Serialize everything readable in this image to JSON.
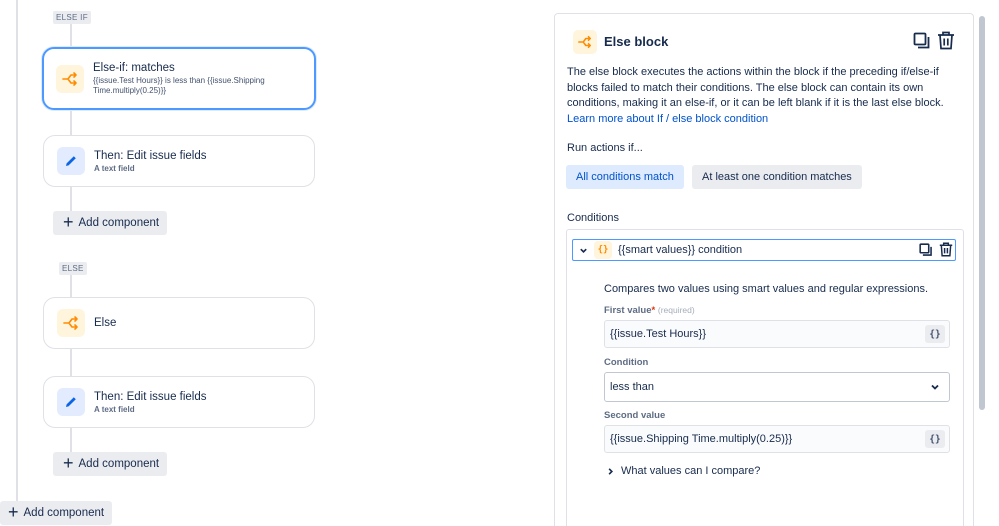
{
  "canvas": {
    "tags": {
      "else_if": "ELSE IF",
      "else": "ELSE"
    },
    "cards": [
      {
        "title": "Else-if: matches",
        "subtitle": "{{issue.Test Hours}} is less than {{issue.Shipping Time.multiply(0.25)}}",
        "icon": "branch-icon"
      },
      {
        "title": "Then: Edit issue fields",
        "subtitle": "A text field",
        "icon": "pencil-icon"
      },
      {
        "title": "Else",
        "subtitle": "",
        "icon": "branch-icon"
      },
      {
        "title": "Then: Edit issue fields",
        "subtitle": "A text field",
        "icon": "pencil-icon"
      }
    ],
    "add_component_label": "Add component"
  },
  "panel": {
    "title": "Else block",
    "description": "The else block executes the actions within the block if the preceding if/else-if blocks failed to match their conditions. The else block can contain its own conditions, making it an else-if, or it can be left blank if it is the last else block.",
    "learn_more": "Learn more about If / else block condition",
    "run_actions_label": "Run actions if...",
    "run_options": [
      "All conditions match",
      "At least one condition matches"
    ],
    "selected_run_option": "All conditions match",
    "conditions_label": "Conditions",
    "condition": {
      "icon_text": "{}",
      "title": "{{smart values}} condition",
      "description": "Compares two values using smart values and regular expressions.",
      "first_value_label": "First value",
      "required_mark": "*",
      "required_text": "(required)",
      "first_value": "{{issue.Test Hours}}",
      "condition_label": "Condition",
      "condition_value": "less than",
      "second_value_label": "Second value",
      "second_value": "{{issue.Shipping Time.multiply(0.25)}}",
      "smart_value_button": "{}",
      "compare_help": "What values can I compare?"
    }
  },
  "colors": {
    "accent": "#0052cc",
    "selected_border": "#4c9aff",
    "branch_icon": "#ff8b00",
    "edit_icon": "#0c66e4"
  }
}
